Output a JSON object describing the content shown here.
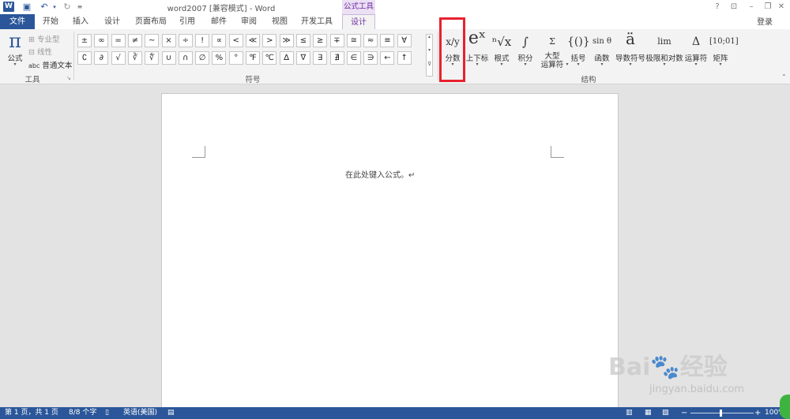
{
  "title_bar": {
    "doc_title": "word2007 [兼容模式] - Word",
    "context_tab": "公式工具",
    "help": "?",
    "icons": [
      "word-icon",
      "save-icon",
      "undo-icon",
      "redo-icon",
      "customize-icon",
      "help-icon",
      "ribbon-display-icon",
      "minimize-icon",
      "restore-icon",
      "close-icon"
    ]
  },
  "tabs": [
    "文件",
    "开始",
    "插入",
    "设计",
    "页面布局",
    "引用",
    "邮件",
    "审阅",
    "视图",
    "开发工具",
    "设计"
  ],
  "login": "登录",
  "tools": {
    "formula": "公式",
    "pro": "专业型",
    "linear": "线性",
    "normal_prefix": "abc",
    "normal": "普通文本",
    "label": "工具"
  },
  "symbols": {
    "row1": [
      "±",
      "∞",
      "=",
      "≠",
      "~",
      "×",
      "÷",
      "!",
      "∝",
      "<",
      "≪",
      ">",
      "≫",
      "≤",
      "≥",
      "∓",
      "≅",
      "≈",
      "≡",
      "∀"
    ],
    "row2": [
      "∁",
      "∂",
      "√",
      "∛",
      "∜",
      "∪",
      "∩",
      "∅",
      "%",
      "°",
      "℉",
      "℃",
      "∆",
      "∇",
      "∃",
      "∄",
      "∈",
      "∋",
      "←",
      "↑"
    ],
    "label": "符号"
  },
  "structures": {
    "items": [
      {
        "icon": "x/y",
        "label": "分数"
      },
      {
        "icon": "eˣ",
        "label": "上下标"
      },
      {
        "icon": "ⁿ√x",
        "label": "根式"
      },
      {
        "icon": "∫",
        "label": "积分"
      },
      {
        "icon": "Σ",
        "label": "大型运算符"
      },
      {
        "icon": "{()}",
        "label": "括号"
      },
      {
        "icon": "sin θ",
        "label": "函数"
      },
      {
        "icon": "ä",
        "label": "导数符号"
      },
      {
        "icon": "lim",
        "label": "极限和对数"
      },
      {
        "icon": "Δ",
        "label": "运算符"
      },
      {
        "icon": "[10;01]",
        "label": "矩阵"
      }
    ],
    "big_op_line2": "运算符",
    "label": "结构"
  },
  "document": {
    "placeholder": "在此处键入公式。↵"
  },
  "status": {
    "page": "第 1 页，共 1 页",
    "words": "8/8 个字",
    "lang": "英语(美国)",
    "zoom": "100%"
  },
  "watermark": {
    "brand": "Bai🐾经验",
    "url": "jingyan.baidu.com"
  }
}
